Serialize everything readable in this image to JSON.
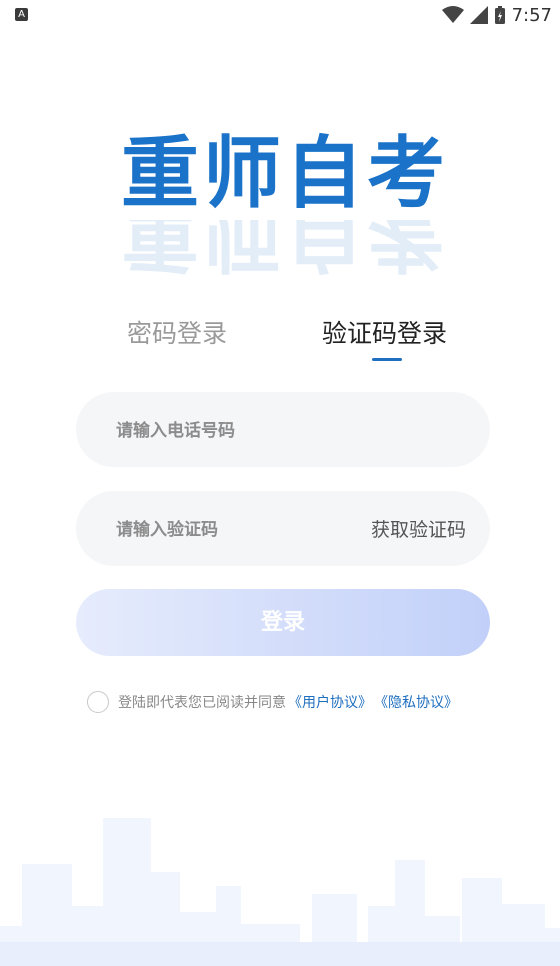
{
  "statusbar": {
    "time": "7:57",
    "left_icon": "A"
  },
  "logo": {
    "text": "重师自考"
  },
  "tabs": [
    {
      "label": "密码登录",
      "active": false
    },
    {
      "label": "验证码登录",
      "active": true
    }
  ],
  "form": {
    "phone_placeholder": "请输入电话号码",
    "code_placeholder": "请输入验证码",
    "get_code_label": "获取验证码",
    "login_label": "登录"
  },
  "agreement": {
    "text": "登陆即代表您已阅读并同意",
    "user_agreement": "《用户协议》",
    "privacy_agreement": "《隐私协议》"
  },
  "colors": {
    "accent": "#1f6fc0",
    "logo": "#1a73c9",
    "button_gradient_start": "#e6ecfc",
    "button_gradient_end": "#c2d0f9"
  }
}
